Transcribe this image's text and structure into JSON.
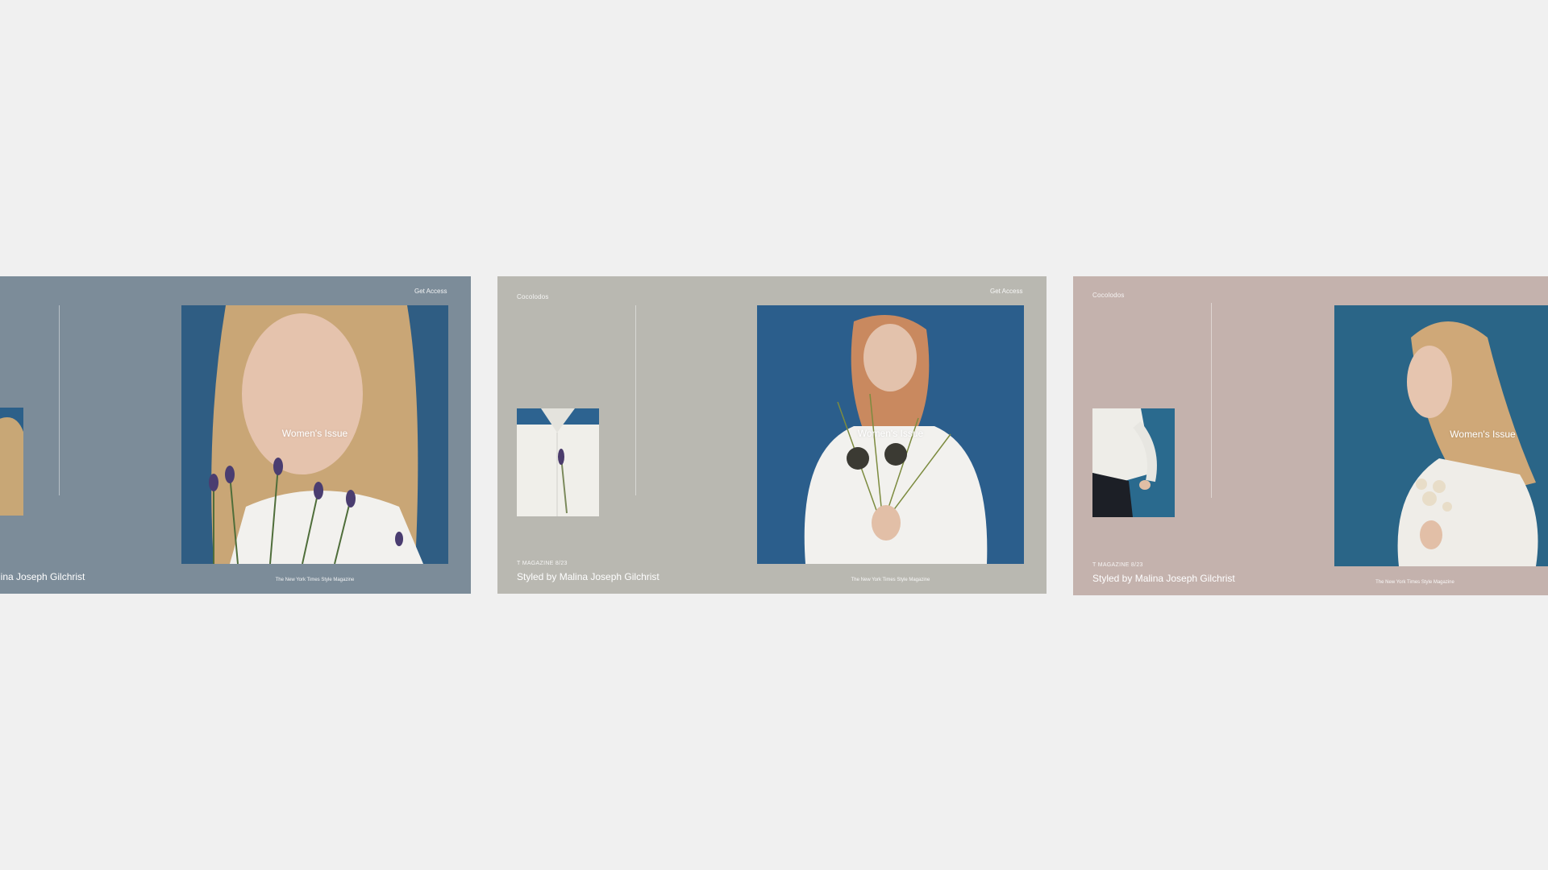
{
  "colors": {
    "page_background": "#f0f0f0",
    "card_1_background": "#7c8c99",
    "card_2_background": "#b9b8b1",
    "card_3_background": "#c4b2ad",
    "photo_background": "#2a5a82"
  },
  "cards": [
    {
      "cta": "Get Access",
      "hero_title": "Women's Issue",
      "styled_by": "lina Joseph Gilchrist",
      "publication": "The New York Times Style Magazine"
    },
    {
      "brand": "Cocolodos",
      "cta": "Get Access",
      "hero_title": "Women's Issue",
      "issue": "T MAGAZINE 8/23",
      "styled_by": "Styled by Malina Joseph Gilchrist",
      "publication": "The New York Times Style Magazine"
    },
    {
      "brand": "Cocolodos",
      "hero_title": "Women's Issue",
      "issue": "T MAGAZINE 8/23",
      "styled_by": "Styled by Malina Joseph Gilchrist",
      "publication": "The New York Times Style Magazine"
    }
  ]
}
